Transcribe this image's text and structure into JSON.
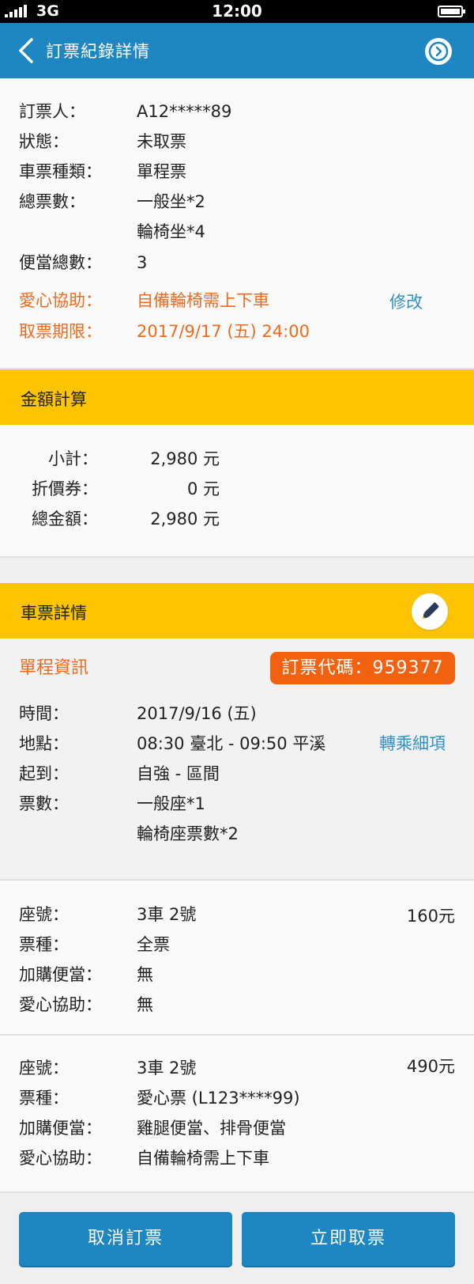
{
  "status_bar": {
    "network": "3G",
    "time": "12:00"
  },
  "nav": {
    "title": "訂票紀錄詳情"
  },
  "booking": {
    "booker_label": "訂票人：",
    "booker_value": "A12*****89",
    "status_label": "狀態：",
    "status_value": "未取票",
    "ticket_type_label": "車票種類：",
    "ticket_type_value": "單程票",
    "total_tickets_label": "總票數：",
    "total_tickets_value_1": "一般坐*2",
    "total_tickets_value_2": "輪椅坐*4",
    "bento_label": "便當總數：",
    "bento_value": "3",
    "assist_label": "愛心協助：",
    "assist_value": "自備輪椅需上下車",
    "modify_link": "修改",
    "deadline_label": "取票期限：",
    "deadline_value": "2017/9/17 (五) 24:00"
  },
  "amount": {
    "header": "金額計算",
    "subtotal_label": "小計：",
    "subtotal_value": "2,980 元",
    "coupon_label": "折價券：",
    "coupon_value": "0 元",
    "total_label": "總金額：",
    "total_value": "2,980 元"
  },
  "ticket_details": {
    "header": "車票詳情",
    "trip_title": "單程資訊",
    "booking_code": "訂票代碼：959377",
    "time_label": "時間：",
    "time_value": "2017/9/16 (五)",
    "place_label": "地點：",
    "place_value": "08:30 臺北 - 09:50 平溪",
    "transfer_link": "轉乘細項",
    "route_label": "起到：",
    "route_value": "自強 - 區間",
    "count_label": "票數：",
    "count_value_1": "一般座*1",
    "count_value_2": "輪椅座票數*2"
  },
  "passengers": [
    {
      "seat_label": "座號：",
      "seat_value": "3車 2號",
      "price": "160元",
      "type_label": "票種：",
      "type_value": "全票",
      "bento_label": "加購便當：",
      "bento_value": "無",
      "assist_label": "愛心協助：",
      "assist_value": "無"
    },
    {
      "seat_label": "座號：",
      "seat_value": "3車 2號",
      "price": "490元",
      "type_label": "票種：",
      "type_value": "愛心票 (L123****99)",
      "bento_label": "加購便當：",
      "bento_value": "雞腿便當、排骨便當",
      "assist_label": "愛心協助：",
      "assist_value": "自備輪椅需上下車"
    }
  ],
  "actions": {
    "cancel": "取消訂票",
    "pickup": "立即取票"
  },
  "colors": {
    "primary": "#1e86c1",
    "accent_yellow": "#ffc400",
    "orange": "#f06a1d",
    "badge": "#f2610f",
    "link": "#2f90c9"
  },
  "icons": {
    "back": "chevron-left-icon",
    "nav_right": "circle-chevron-right-icon",
    "edit": "pencil-icon"
  }
}
